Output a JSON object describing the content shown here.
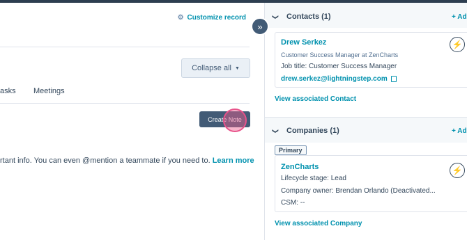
{
  "main": {
    "customize_label": "Customize record",
    "collapse_label": "Collapse all",
    "tabs": [
      {
        "label": "asks"
      },
      {
        "label": "Meetings"
      }
    ],
    "create_note_label": "Create Note",
    "info_text": "rtant info. You can even @mention a teammate if you need to.",
    "learn_more": "Learn more"
  },
  "sidebar": {
    "contacts": {
      "title": "Contacts (1)",
      "add_label": "+ Add",
      "card": {
        "name": "Drew Serkez",
        "subtitle": "Customer Success Manager at ZenCharts",
        "job_title": "Job title:  Customer Success Manager",
        "email": "drew.serkez@lightningstep.com"
      },
      "view_link": "View associated Contact"
    },
    "companies": {
      "title": "Companies (1)",
      "add_label": "+ Add",
      "tag": "Primary",
      "card": {
        "name": "ZenCharts",
        "lifecycle": "Lifecycle stage:  Lead",
        "owner": "Company owner:  Brendan Orlando (Deactivated...",
        "csm": "CSM:  --"
      },
      "view_link": "View associated Company"
    }
  },
  "icons": {
    "gear": "gear-icon",
    "expand": "double-chevron-right-icon",
    "bolt": "lightning-bolt-icon",
    "copy": "copy-icon"
  },
  "colors": {
    "link": "#0091ae",
    "dark_button": "#425b76",
    "bolt": "#f5a623",
    "click_highlight": "#e8528a"
  }
}
